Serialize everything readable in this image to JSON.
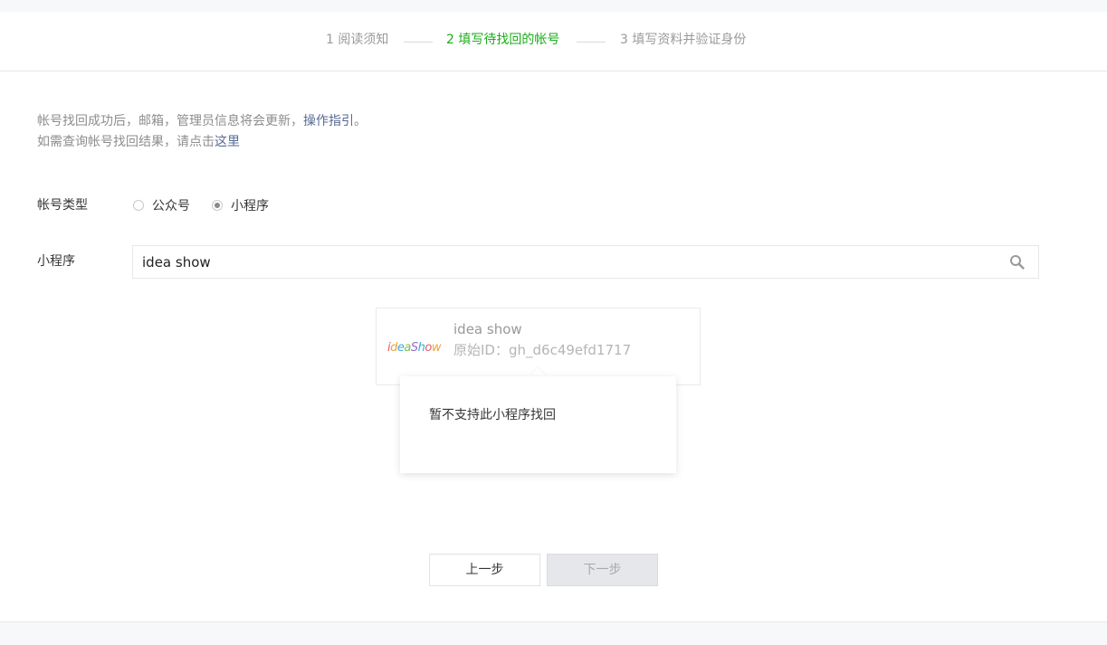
{
  "steps": [
    {
      "label": "1 阅读须知",
      "active": false
    },
    {
      "label": "2 填写待找回的帐号",
      "active": true
    },
    {
      "label": "3 填写资料并验证身份",
      "active": false
    }
  ],
  "notice": {
    "line1_text": "帐号找回成功后，邮箱，管理员信息将会更新，",
    "line1_link": "操作指引",
    "line1_end": "。",
    "line2_text": "如需查询帐号找回结果，请点击",
    "line2_link": "这里"
  },
  "account_type": {
    "label": "帐号类型",
    "options": [
      {
        "label": "公众号",
        "checked": false
      },
      {
        "label": "小程序",
        "checked": true
      }
    ]
  },
  "mini_program": {
    "label": "小程序",
    "search_value": "idea show"
  },
  "result": {
    "logo_text": "ideaShow",
    "name": "idea show",
    "original_id": "原始ID：gh_d6c49efd1717"
  },
  "tooltip": {
    "message": "暂不支持此小程序找回"
  },
  "buttons": {
    "prev": "上一步",
    "next": "下一步"
  },
  "colors": {
    "accent": "#1aad19",
    "link": "#576b95"
  }
}
